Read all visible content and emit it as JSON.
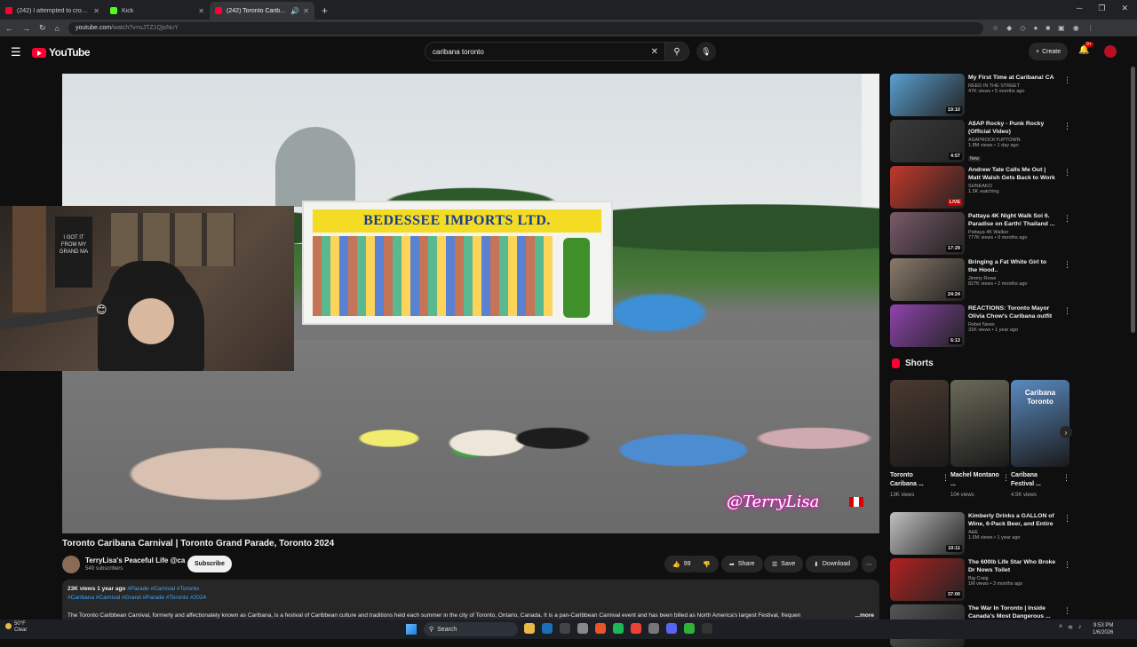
{
  "browser": {
    "tabs": [
      {
        "title": "(242) I attempted to cross Engl",
        "favicon": "youtube"
      },
      {
        "title": "Kick",
        "favicon": "kick"
      },
      {
        "title": "(242) Toronto Caribana Ca",
        "favicon": "youtube"
      }
    ],
    "url_host": "youtube.com",
    "url_path": "/watch?v=uJTZ1QjsNuY"
  },
  "header": {
    "logo_text": "YouTube",
    "search_value": "caribana toronto",
    "create_label": "Create",
    "notif_badge": "9+"
  },
  "video": {
    "truck_sign": "BEDESSEE IMPORTS LTD.",
    "watermark": "@TerryLisa",
    "title": "Toronto Caribana Carnival | Toronto Grand Parade, Toronto 2024",
    "channel": "TerryLisa's Peaceful Life @ca",
    "subscribers": "549 subscribers",
    "subscribe_label": "Subscribe",
    "likes": "99",
    "share_label": "Share",
    "save_label": "Save",
    "download_label": "Download",
    "views_date": "23K views  1 year ago",
    "hashtags_line1": "#Parade #Carnival #Toronto",
    "hashtags_line2": "#Caribana #Carnival #Grand #Parade #Toronto #2024",
    "description": "The Toronto Caribbean Carnival, formerly and affectionately known as Caribana, is a festival of Caribbean culture and traditions held each summer in the city of Toronto, Ontario, Canada. It is a pan-Caribbean Carnival event and has been billed as North America's largest Festival, frequen",
    "more_label": "...more"
  },
  "webcam": {
    "poster_text": "I GOT IT FROM MY GRAND MA"
  },
  "recommendations": [
    {
      "title": "My First Time at Caribana! CA",
      "channel": "REED IN THE STREET",
      "meta": "47K views • 5 months ago",
      "duration": "19:10",
      "color": "#5aa0d0"
    },
    {
      "title": "A$AP Rocky - Punk Rocky (Official Video)",
      "channel": "ASAPROCKYUPTOWN",
      "meta": "1.8M views • 1 day ago",
      "badge": "New",
      "duration": "4:57",
      "color": "#3a3a3a"
    },
    {
      "title": "Andrew Tate Calls Me Out | Matt Walsh Gets Back to Work | ...",
      "channel": "SHNEAKO",
      "meta": "1.5K watching",
      "duration": "LIVE",
      "color": "#c0392b"
    },
    {
      "title": "Pattaya 4K Night Walk Soi 6. Paradise on Earth! Thailand ...",
      "channel": "Pattaya 4K Walker",
      "meta": "777K views • 9 months ago",
      "duration": "17:29",
      "color": "#7a5a6a"
    },
    {
      "title": "Bringing a Fat White Girl to the Hood..",
      "channel": "Jimmy Rowe",
      "meta": "827K views • 2 months ago",
      "duration": "24:24",
      "color": "#8a7a6a"
    },
    {
      "title": "REACTIONS: Toronto Mayor Olivia Chow's Caribana outfit ...",
      "channel": "Rebel News",
      "meta": "31K views • 1 year ago",
      "duration": "6:13",
      "color": "#8e44ad"
    }
  ],
  "shorts": {
    "heading": "Shorts",
    "items": [
      {
        "title": "Toronto Caribana ...",
        "views": "13K views",
        "color": "#4a3a30",
        "overlay": ""
      },
      {
        "title": "Machel Montano ...",
        "views": "104 views",
        "color": "#6a6a5a",
        "overlay": ""
      },
      {
        "title": "Caribana Festival ...",
        "views": "4.5K views",
        "color": "#5a8ac0",
        "overlay": "Caribana Toronto"
      }
    ]
  },
  "more_recs": [
    {
      "title": "Kimberly Drinks a GALLON of Wine, 6-Pack Beer, and Entire ...",
      "channel": "A&E",
      "meta": "1.6M views • 1 year ago",
      "duration": "10:11",
      "color": "#c0c0c0"
    },
    {
      "title": "The 600lb Life Star Who Broke Dr Nows Toilet",
      "channel": "Big Craig",
      "meta": "1M views • 3 months ago",
      "duration": "37:00",
      "color": "#b22222"
    },
    {
      "title": "The War In Toronto | Inside Canada's Most Dangerous ...",
      "channel": "",
      "meta": "",
      "duration": "",
      "color": "#555555"
    }
  ],
  "taskbar": {
    "temp": "50°F",
    "weather": "Clear",
    "search_label": "Search",
    "time": "9:53 PM",
    "date": "1/6/2026"
  }
}
